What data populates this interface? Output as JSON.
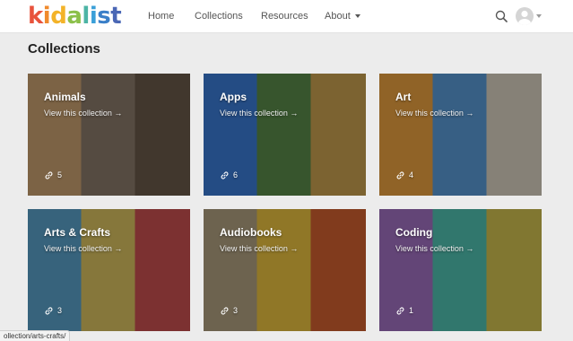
{
  "brand": {
    "logo_letters": [
      {
        "char": "k",
        "color": "#e8533c"
      },
      {
        "char": "i",
        "color": "#f08a2c"
      },
      {
        "char": "d",
        "color": "#f3b329"
      },
      {
        "char": "a",
        "color": "#8cc04a"
      },
      {
        "char": "l",
        "color": "#4cb4a5"
      },
      {
        "char": "i",
        "color": "#3a9fd8"
      },
      {
        "char": "s",
        "color": "#3a7fc8"
      },
      {
        "char": "t",
        "color": "#4a67b5"
      }
    ]
  },
  "nav": {
    "items": [
      {
        "label": "Home"
      },
      {
        "label": "Collections"
      },
      {
        "label": "Resources"
      },
      {
        "label": "About"
      }
    ],
    "search_icon": "search-icon",
    "avatar_icon": "user-avatar"
  },
  "page": {
    "title": "Collections"
  },
  "collections": [
    {
      "title": "Animals",
      "link_label": "View this collection →",
      "count": "5",
      "colors": [
        "#c8a070",
        "#8a7a6a",
        "#6a5a4a"
      ]
    },
    {
      "title": "Apps",
      "link_label": "View this collection →",
      "count": "6",
      "colors": [
        "#3a7bd5",
        "#5a8a4a",
        "#c8a050"
      ]
    },
    {
      "title": "Art",
      "link_label": "View this collection →",
      "count": "4",
      "colors": [
        "#e8a040",
        "#5a9ad5",
        "#d8d0c0"
      ]
    },
    {
      "title": "Arts & Crafts",
      "link_label": "View this collection →",
      "count": "3",
      "colors": [
        "#5aa0c8",
        "#d8c060",
        "#c85050"
      ]
    },
    {
      "title": "Audiobooks",
      "link_label": "View this collection →",
      "count": "3",
      "colors": [
        "#b0a080",
        "#e8c040",
        "#d06030"
      ]
    },
    {
      "title": "Coding",
      "link_label": "View this collection →",
      "count": "1",
      "colors": [
        "#a070c0",
        "#50c0b0",
        "#d0c050"
      ]
    }
  ],
  "status_bar": {
    "url": "ollection/arts-crafts/"
  }
}
